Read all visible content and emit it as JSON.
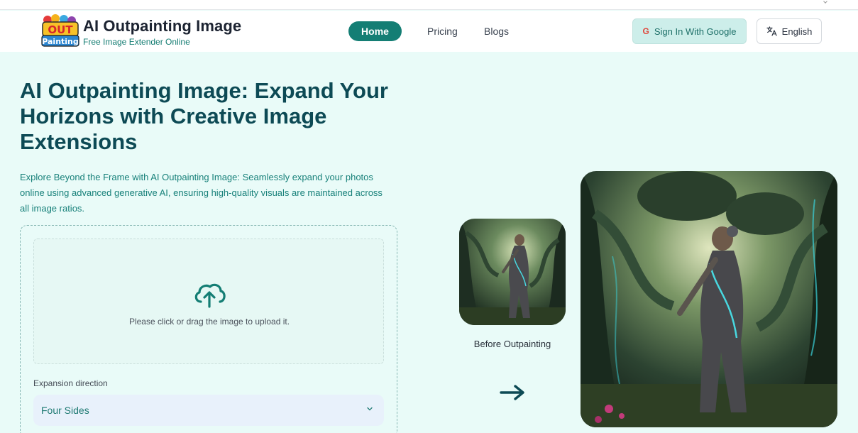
{
  "brand": {
    "logo_line1": "OUT",
    "logo_line2": "Painting",
    "title": "AI Outpainting Image",
    "subtitle": "Free Image Extender Online"
  },
  "nav": {
    "home": "Home",
    "pricing": "Pricing",
    "blogs": "Blogs"
  },
  "auth": {
    "signin_label": "Sign In With Google",
    "google_glyph": "G"
  },
  "language": {
    "selected": "English"
  },
  "hero": {
    "title": "AI Outpainting Image: Expand Your Horizons with Creative Image Extensions",
    "description": "Explore Beyond the Frame with AI Outpainting Image: Seamlessly expand your photos online using advanced generative AI, ensuring high-quality visuals are maintained across all image ratios."
  },
  "upload": {
    "prompt": "Please click or drag the image to upload it."
  },
  "expansion": {
    "label": "Expansion direction",
    "selected": "Four Sides"
  },
  "preview": {
    "before_caption": "Before Outpainting"
  },
  "colors": {
    "accent": "#147e74",
    "heading": "#0d4a55",
    "page_background": "#e9fbf8"
  }
}
